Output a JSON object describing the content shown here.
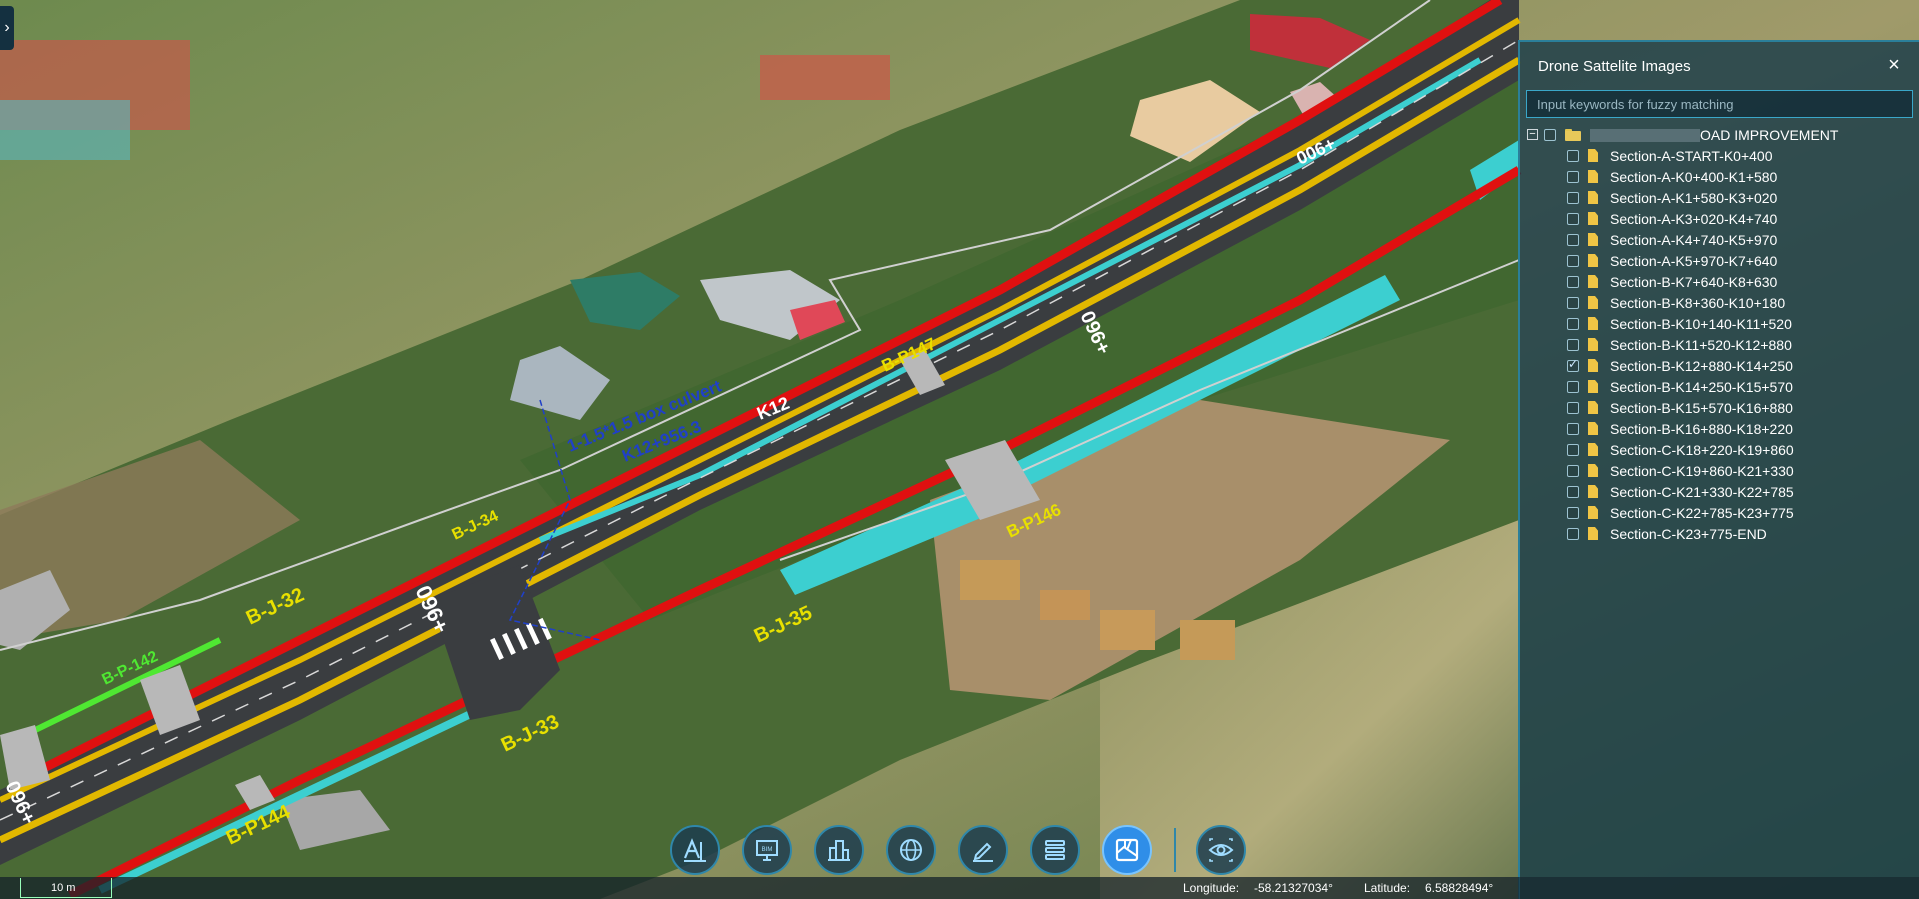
{
  "panel": {
    "title": "Drone Sattelite Images",
    "search_placeholder": "Input keywords for fuzzy matching",
    "root_label_end": "OAD IMPROVEMENT",
    "sections": [
      {
        "label": "Section-A-START-K0+400",
        "checked": false
      },
      {
        "label": "Section-A-K0+400-K1+580",
        "checked": false
      },
      {
        "label": "Section-A-K1+580-K3+020",
        "checked": false
      },
      {
        "label": "Section-A-K3+020-K4+740",
        "checked": false
      },
      {
        "label": "Section-A-K4+740-K5+970",
        "checked": false
      },
      {
        "label": "Section-A-K5+970-K7+640",
        "checked": false
      },
      {
        "label": "Section-B-K7+640-K8+630",
        "checked": false
      },
      {
        "label": "Section-B-K8+360-K10+180",
        "checked": false
      },
      {
        "label": "Section-B-K10+140-K11+520",
        "checked": false
      },
      {
        "label": "Section-B-K11+520-K12+880",
        "checked": false
      },
      {
        "label": "Section-B-K12+880-K14+250",
        "checked": true
      },
      {
        "label": "Section-B-K14+250-K15+570",
        "checked": false
      },
      {
        "label": "Section-B-K15+570-K16+880",
        "checked": false
      },
      {
        "label": "Section-B-K16+880-K18+220",
        "checked": false
      },
      {
        "label": "Section-C-K18+220-K19+860",
        "checked": false
      },
      {
        "label": "Section-C-K19+860-K21+330",
        "checked": false
      },
      {
        "label": "Section-C-K21+330-K22+785",
        "checked": false
      },
      {
        "label": "Section-C-K22+785-K23+775",
        "checked": false
      },
      {
        "label": "Section-C-K23+775-END",
        "checked": false
      }
    ]
  },
  "map": {
    "labels": {
      "culvert_1": "1-1.5*1.5 box culvert",
      "culvert_2": "K12+956.3",
      "km": "K12",
      "bp147": "B-P147",
      "bp146": "B-P146",
      "bp144": "B-P144",
      "bj34": "B-J-34",
      "bj32": "B-J-32",
      "bj33": "B-J-33",
      "bj35": "B-J-35",
      "bp1": "B-P-142",
      "st1": "096+",
      "st2": "096+",
      "st3": "006+",
      "st4": "096+"
    }
  },
  "toolbar": {
    "tools": [
      {
        "name": "measure-tool-icon",
        "active": false
      },
      {
        "name": "bim-tool-icon",
        "active": false
      },
      {
        "name": "buildings-tool-icon",
        "active": false
      },
      {
        "name": "globe-tool-icon",
        "active": false
      },
      {
        "name": "draw-tool-icon",
        "active": false
      },
      {
        "name": "layers-tool-icon",
        "active": false
      },
      {
        "name": "drone-images-tool-icon",
        "active": true
      },
      {
        "name": "view-tool-icon",
        "active": false
      }
    ]
  },
  "status": {
    "scale": "10 m",
    "longitude_label": "Longitude:",
    "longitude_value": "-58.21327034°",
    "latitude_label": "Latitude:",
    "latitude_value": "6.58828494°"
  },
  "colors": {
    "road_red": "#e01010",
    "road_yellow": "#e2b800",
    "road_cyan": "#3ccfd0",
    "road_green": "#4fe832",
    "asphalt": "#3a3d40",
    "panel_border": "#2b7f9a",
    "active_tool": "#2f8ee8"
  }
}
